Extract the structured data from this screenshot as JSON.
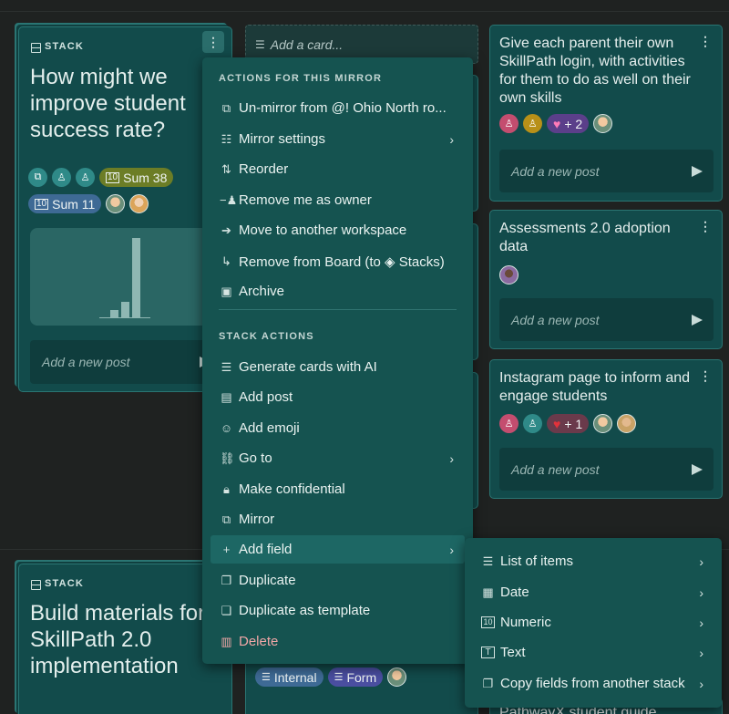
{
  "stack_top": {
    "label": "STACK",
    "title": "How might we improve student success rate?",
    "chips": {
      "sum_a": "Sum 38",
      "sum_b": "Sum 11"
    },
    "chart_data": {
      "type": "bar",
      "values": [
        1,
        2,
        10
      ],
      "ylim": [
        0,
        10
      ]
    },
    "post_placeholder": "Add a new post"
  },
  "add_card_label": "Add a card...",
  "cards_right": [
    {
      "title": "Give each parent their own SkillPath login, with activities for them to do as well on their own skills",
      "chip": "+ 2",
      "post_placeholder": "Add a new post"
    },
    {
      "title": "Assessments 2.0 adoption data",
      "post_placeholder": "Add a new post"
    },
    {
      "title": "Instagram page to inform and engage students",
      "chip": "+ 1",
      "post_placeholder": "Add a new post"
    }
  ],
  "stack_bottom": {
    "label": "STACK",
    "title": "Build materials for SkillPath 2.0 implementation",
    "chips": {
      "internal": "Internal",
      "form": "Form"
    },
    "partial_card": "PathwayX student guide"
  },
  "menu": {
    "section1": "ACTIONS FOR THIS MIRROR",
    "items1": [
      {
        "label": "Un-mirror from @! Ohio North ro...",
        "icon": "mirror-icon"
      },
      {
        "label": "Mirror settings",
        "icon": "sliders-icon"
      },
      {
        "label": "Reorder",
        "icon": "reorder-icon"
      },
      {
        "label": "Remove me as owner",
        "icon": "user-minus-icon"
      },
      {
        "label": "Move to another workspace",
        "icon": "move-icon"
      },
      {
        "label": "Remove from Board (to ◈ Stacks)",
        "icon": "return-arrow-icon"
      },
      {
        "label": "Archive",
        "icon": "archive-icon"
      }
    ],
    "section2": "STACK ACTIONS",
    "items2": [
      {
        "label": "Generate cards with AI",
        "icon": "ai-cards-icon"
      },
      {
        "label": "Add post",
        "icon": "comment-icon"
      },
      {
        "label": "Add emoji",
        "icon": "emoji-icon"
      },
      {
        "label": "Go to",
        "icon": "link-icon"
      },
      {
        "label": "Make confidential",
        "icon": "lock-icon"
      },
      {
        "label": "Mirror",
        "icon": "mirror-icon"
      },
      {
        "label": "Add field",
        "icon": "plus-icon"
      },
      {
        "label": "Duplicate",
        "icon": "duplicate-icon"
      },
      {
        "label": "Duplicate as template",
        "icon": "template-icon"
      },
      {
        "label": "Delete",
        "icon": "trash-icon"
      }
    ]
  },
  "submenu": {
    "items": [
      {
        "label": "List of items",
        "icon": "list-icon"
      },
      {
        "label": "Date",
        "icon": "calendar-icon"
      },
      {
        "label": "Numeric",
        "icon": "numeric-icon"
      },
      {
        "label": "Text",
        "icon": "text-icon"
      },
      {
        "label": "Copy fields from another stack",
        "icon": "copy-icon"
      }
    ]
  },
  "colors": {
    "card": "#124b4b",
    "menu": "#155350",
    "highlight": "#1d6764",
    "danger": "#f1a7a7"
  }
}
